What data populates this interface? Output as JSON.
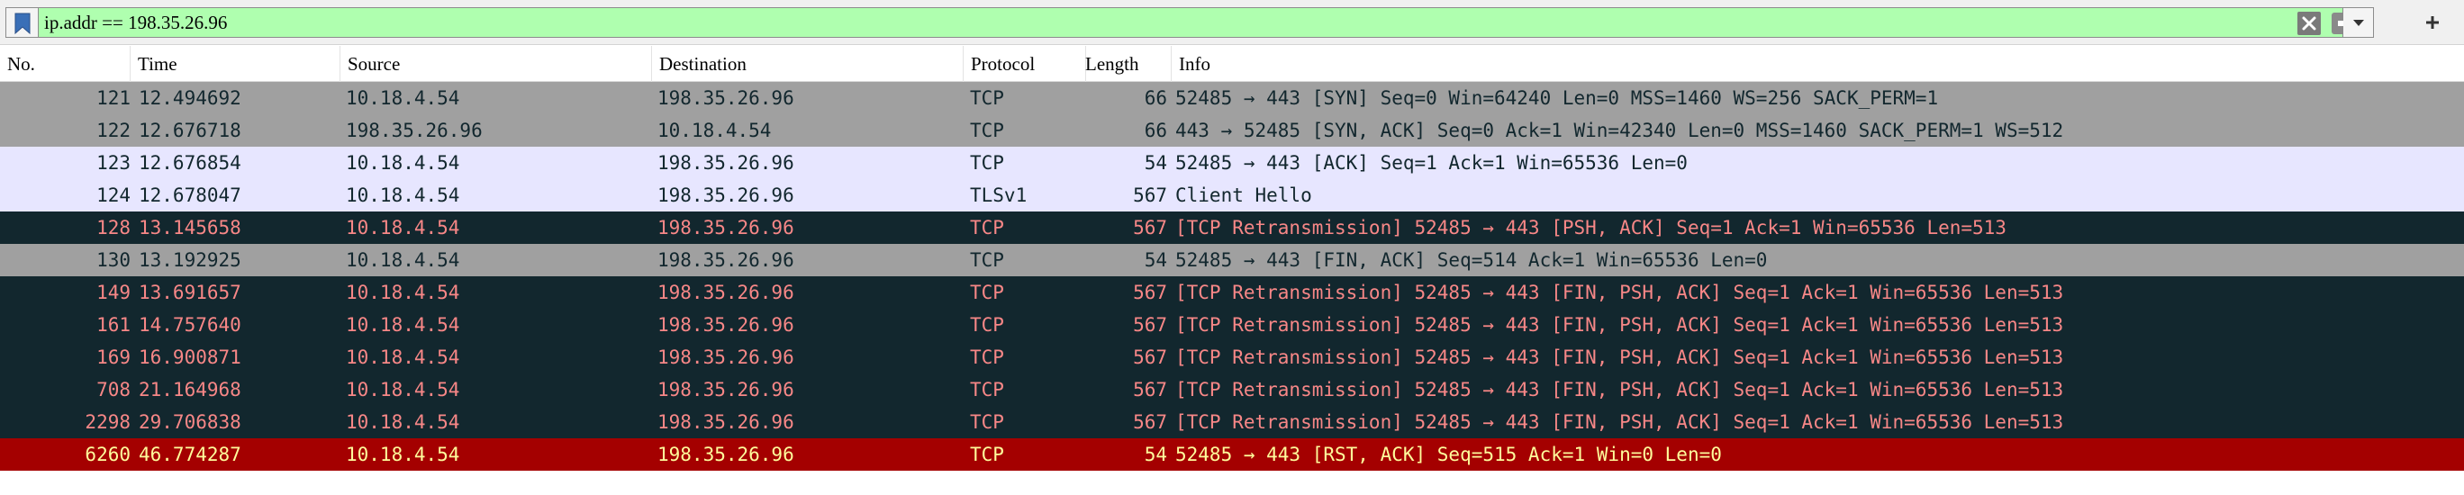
{
  "filter": {
    "value": "ip.addr == 198.35.26.96",
    "bg_color": "#afffaf"
  },
  "icons": {
    "bookmark": "bookmark-icon",
    "clear": "clear-filter-icon",
    "apply": "apply-arrow-icon",
    "dropdown": "chevron-down-icon",
    "add": "plus-icon"
  },
  "columns": [
    "No.",
    "Time",
    "Source",
    "Destination",
    "Protocol",
    "Length",
    "Info"
  ],
  "row_styles": {
    "gray": {
      "bg": "#a0a0a0",
      "fg": "#12272e"
    },
    "lavender": {
      "bg": "#e7e6ff",
      "fg": "#12272e"
    },
    "dark": {
      "bg": "#12272e",
      "fg": "#f78787"
    },
    "red": {
      "bg": "#a40000",
      "fg": "#fffc9c"
    }
  },
  "packets": [
    {
      "no": "121",
      "time": "12.494692",
      "src": "10.18.4.54",
      "dst": "198.35.26.96",
      "proto": "TCP",
      "len": "66",
      "info": "52485 → 443 [SYN] Seq=0 Win=64240 Len=0 MSS=1460 WS=256 SACK_PERM=1",
      "style": "gray"
    },
    {
      "no": "122",
      "time": "12.676718",
      "src": "198.35.26.96",
      "dst": "10.18.4.54",
      "proto": "TCP",
      "len": "66",
      "info": "443 → 52485 [SYN, ACK] Seq=0 Ack=1 Win=42340 Len=0 MSS=1460 SACK_PERM=1 WS=512",
      "style": "gray"
    },
    {
      "no": "123",
      "time": "12.676854",
      "src": "10.18.4.54",
      "dst": "198.35.26.96",
      "proto": "TCP",
      "len": "54",
      "info": "52485 → 443 [ACK] Seq=1 Ack=1 Win=65536 Len=0",
      "style": "lavender"
    },
    {
      "no": "124",
      "time": "12.678047",
      "src": "10.18.4.54",
      "dst": "198.35.26.96",
      "proto": "TLSv1",
      "len": "567",
      "info": "Client Hello",
      "style": "lavender"
    },
    {
      "no": "128",
      "time": "13.145658",
      "src": "10.18.4.54",
      "dst": "198.35.26.96",
      "proto": "TCP",
      "len": "567",
      "info": "[TCP Retransmission] 52485 → 443 [PSH, ACK] Seq=1 Ack=1 Win=65536 Len=513",
      "style": "dark"
    },
    {
      "no": "130",
      "time": "13.192925",
      "src": "10.18.4.54",
      "dst": "198.35.26.96",
      "proto": "TCP",
      "len": "54",
      "info": "52485 → 443 [FIN, ACK] Seq=514 Ack=1 Win=65536 Len=0",
      "style": "gray"
    },
    {
      "no": "149",
      "time": "13.691657",
      "src": "10.18.4.54",
      "dst": "198.35.26.96",
      "proto": "TCP",
      "len": "567",
      "info": "[TCP Retransmission] 52485 → 443 [FIN, PSH, ACK] Seq=1 Ack=1 Win=65536 Len=513",
      "style": "dark"
    },
    {
      "no": "161",
      "time": "14.757640",
      "src": "10.18.4.54",
      "dst": "198.35.26.96",
      "proto": "TCP",
      "len": "567",
      "info": "[TCP Retransmission] 52485 → 443 [FIN, PSH, ACK] Seq=1 Ack=1 Win=65536 Len=513",
      "style": "dark"
    },
    {
      "no": "169",
      "time": "16.900871",
      "src": "10.18.4.54",
      "dst": "198.35.26.96",
      "proto": "TCP",
      "len": "567",
      "info": "[TCP Retransmission] 52485 → 443 [FIN, PSH, ACK] Seq=1 Ack=1 Win=65536 Len=513",
      "style": "dark"
    },
    {
      "no": "708",
      "time": "21.164968",
      "src": "10.18.4.54",
      "dst": "198.35.26.96",
      "proto": "TCP",
      "len": "567",
      "info": "[TCP Retransmission] 52485 → 443 [FIN, PSH, ACK] Seq=1 Ack=1 Win=65536 Len=513",
      "style": "dark"
    },
    {
      "no": "2298",
      "time": "29.706838",
      "src": "10.18.4.54",
      "dst": "198.35.26.96",
      "proto": "TCP",
      "len": "567",
      "info": "[TCP Retransmission] 52485 → 443 [FIN, PSH, ACK] Seq=1 Ack=1 Win=65536 Len=513",
      "style": "dark"
    },
    {
      "no": "6260",
      "time": "46.774287",
      "src": "10.18.4.54",
      "dst": "198.35.26.96",
      "proto": "TCP",
      "len": "54",
      "info": "52485 → 443 [RST, ACK] Seq=515 Ack=1 Win=0 Len=0",
      "style": "red"
    }
  ]
}
